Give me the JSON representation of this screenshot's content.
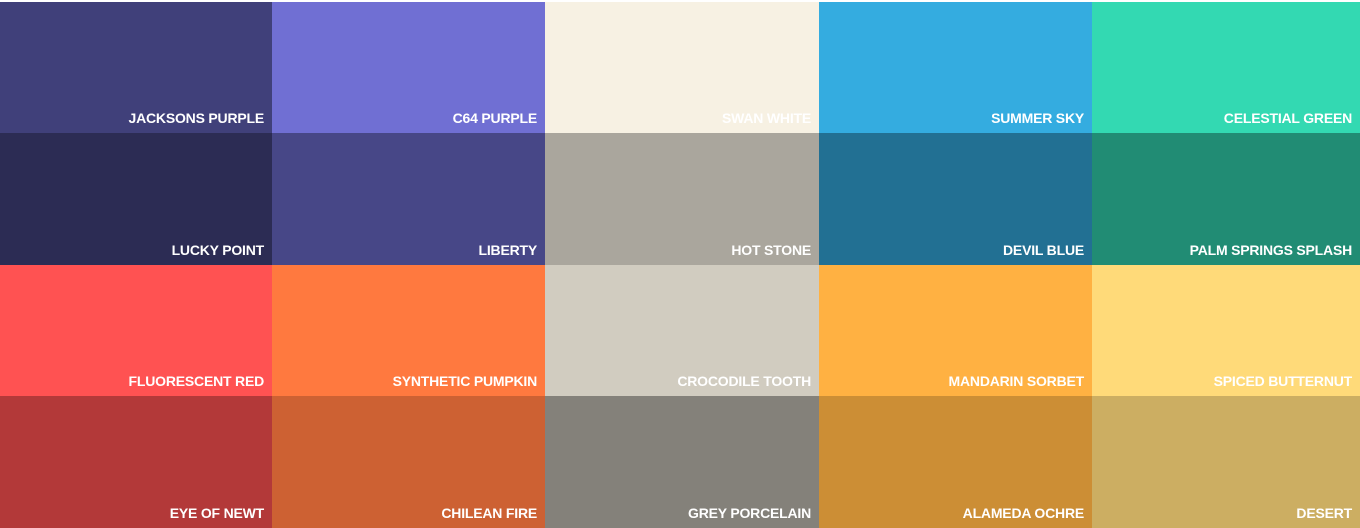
{
  "palette": {
    "rows": [
      [
        {
          "name": "JACKSONS PURPLE",
          "color": "#40407a"
        },
        {
          "name": "C64 PURPLE",
          "color": "#706fd3"
        },
        {
          "name": "SWAN WHITE",
          "color": "#f7f1e3"
        },
        {
          "name": "SUMMER SKY",
          "color": "#34ace0"
        },
        {
          "name": "CELESTIAL GREEN",
          "color": "#33d9b2"
        }
      ],
      [
        {
          "name": "LUCKY POINT",
          "color": "#2c2c54"
        },
        {
          "name": "LIBERTY",
          "color": "#474787"
        },
        {
          "name": "HOT STONE",
          "color": "#aaa69d"
        },
        {
          "name": "DEVIL BLUE",
          "color": "#227093"
        },
        {
          "name": "PALM SPRINGS SPLASH",
          "color": "#218c74"
        }
      ],
      [
        {
          "name": "FLUORESCENT RED",
          "color": "#ff5252"
        },
        {
          "name": "SYNTHETIC PUMPKIN",
          "color": "#ff793f"
        },
        {
          "name": "CROCODILE TOOTH",
          "color": "#d1ccc0"
        },
        {
          "name": "MANDARIN SORBET",
          "color": "#ffb142"
        },
        {
          "name": "SPICED BUTTERNUT",
          "color": "#ffda79"
        }
      ],
      [
        {
          "name": "EYE OF NEWT",
          "color": "#b33939"
        },
        {
          "name": "CHILEAN FIRE",
          "color": "#cd6133"
        },
        {
          "name": "GREY PORCELAIN",
          "color": "#84817a"
        },
        {
          "name": "ALAMEDA OCHRE",
          "color": "#cc8e35"
        },
        {
          "name": "DESERT",
          "color": "#ccae62"
        }
      ]
    ]
  }
}
